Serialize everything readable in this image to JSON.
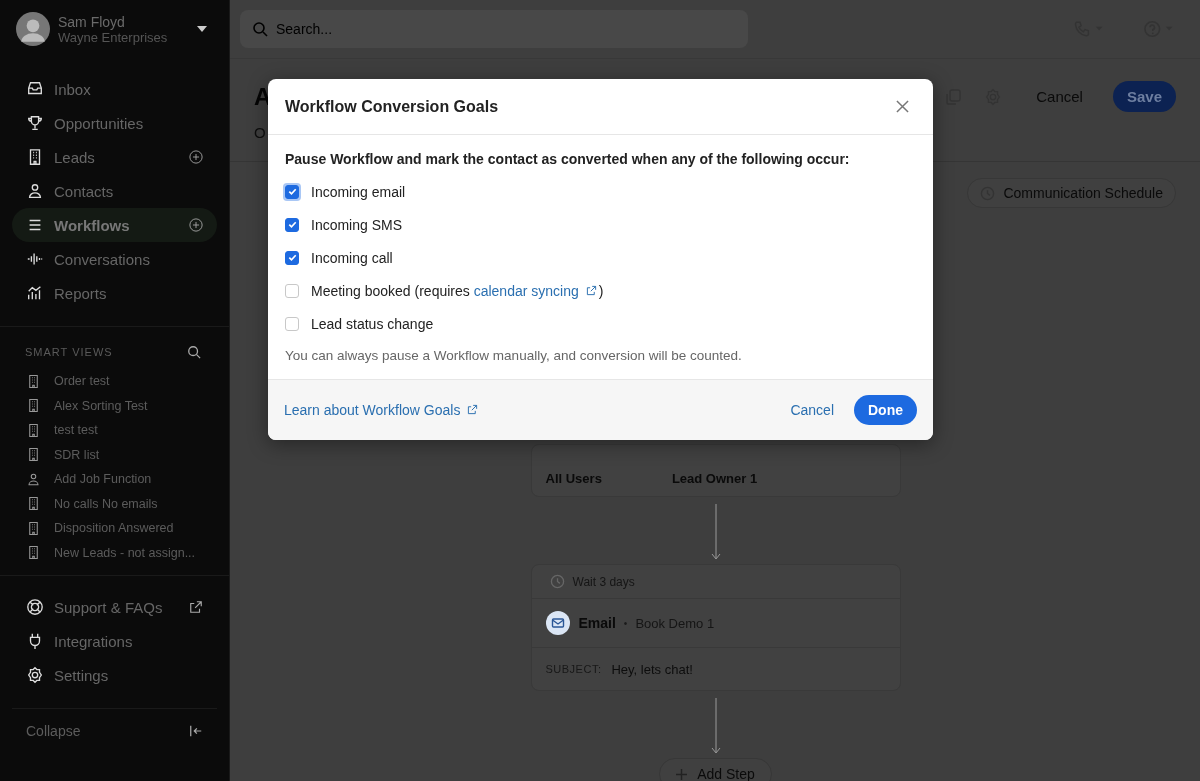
{
  "user": {
    "name": "Sam Floyd",
    "company": "Wayne Enterprises"
  },
  "nav": [
    {
      "label": "Inbox",
      "selected": false,
      "add": false
    },
    {
      "label": "Opportunities",
      "selected": false,
      "add": false
    },
    {
      "label": "Leads",
      "selected": false,
      "add": true
    },
    {
      "label": "Contacts",
      "selected": false,
      "add": false
    },
    {
      "label": "Workflows",
      "selected": true,
      "add": true
    },
    {
      "label": "Conversations",
      "selected": false,
      "add": false
    },
    {
      "label": "Reports",
      "selected": false,
      "add": false
    }
  ],
  "smart_views": {
    "heading": "SMART VIEWS",
    "items": [
      {
        "label": "Order test",
        "kind": "lead"
      },
      {
        "label": "Alex Sorting Test",
        "kind": "lead"
      },
      {
        "label": "test test",
        "kind": "lead"
      },
      {
        "label": "SDR list",
        "kind": "lead"
      },
      {
        "label": "Add Job Function",
        "kind": "contact"
      },
      {
        "label": "No calls No emails",
        "kind": "lead"
      },
      {
        "label": "Disposition Answered",
        "kind": "lead"
      },
      {
        "label": "New Leads - not assign...",
        "kind": "lead"
      }
    ]
  },
  "bottom_nav": [
    {
      "label": "Support & FAQs",
      "external": true
    },
    {
      "label": "Integrations",
      "external": false
    },
    {
      "label": "Settings",
      "external": false
    }
  ],
  "collapse": "Collapse",
  "search": {
    "placeholder": "Search..."
  },
  "page": {
    "title": "A",
    "tab": "O",
    "cancel": "Cancel",
    "save": "Save",
    "schedule": "Communication Schedule"
  },
  "flow": {
    "from": "All Users",
    "to": "Lead Owner 1",
    "wait": "Wait 3 days",
    "step_type": "Email",
    "separator": "•",
    "step_name": "Book Demo 1",
    "subject_label": "SUBJECT:",
    "subject": "Hey, lets chat!",
    "add_step": "Add Step"
  },
  "dialog": {
    "title": "Workflow Conversion Goals",
    "lead": "Pause Workflow and mark the contact as converted when any of the following occur:",
    "options": [
      {
        "label": "Incoming email",
        "checked": true,
        "focused": true
      },
      {
        "label": "Incoming SMS",
        "checked": true,
        "focused": false
      },
      {
        "label": "Incoming call",
        "checked": true,
        "focused": false
      },
      {
        "label": "Meeting booked (requires ",
        "link": "calendar syncing",
        "after": ")",
        "checked": false,
        "focused": false
      },
      {
        "label": "Lead status change",
        "checked": false,
        "focused": false
      }
    ],
    "note": "You can always pause a Workflow manually, and conversion will be counted.",
    "learn_link": "Learn about Workflow Goals",
    "cancel": "Cancel",
    "done": "Done"
  }
}
